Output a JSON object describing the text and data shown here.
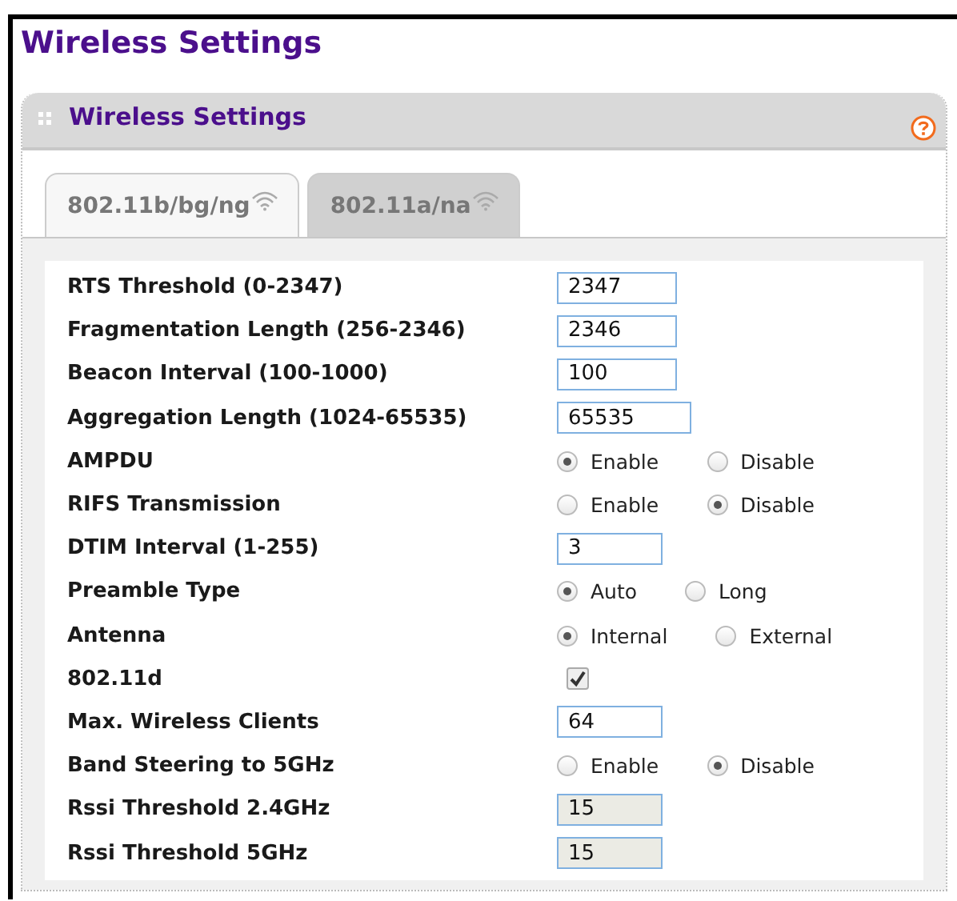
{
  "title": "Wireless Settings",
  "panel": {
    "title": "Wireless Settings"
  },
  "tabs": [
    {
      "label": "802.11b/bg/ng",
      "selected": true
    },
    {
      "label": "802.11a/na",
      "selected": false
    }
  ],
  "rows": [
    {
      "kind": "text",
      "label": "RTS Threshold (0-2347)",
      "value": "2347",
      "disabled": false
    },
    {
      "kind": "text",
      "label": "Fragmentation Length (256-2346)",
      "value": "2346",
      "disabled": false
    },
    {
      "kind": "text",
      "label": "Beacon Interval (100-1000)",
      "value": "100",
      "disabled": false
    },
    {
      "kind": "text",
      "label": "Aggregation Length (1024-65535)",
      "value": "65535",
      "disabled": false
    },
    {
      "kind": "radio",
      "label": "AMPDU",
      "options": [
        {
          "label": "Enable",
          "selected": true
        },
        {
          "label": "Disable",
          "selected": false
        }
      ]
    },
    {
      "kind": "radio",
      "label": "RIFS Transmission",
      "options": [
        {
          "label": "Enable",
          "selected": false
        },
        {
          "label": "Disable",
          "selected": true
        }
      ]
    },
    {
      "kind": "text",
      "label": "DTIM Interval (1-255)",
      "value": "3",
      "disabled": false
    },
    {
      "kind": "radio",
      "label": "Preamble Type",
      "options": [
        {
          "label": "Auto",
          "selected": true
        },
        {
          "label": "Long",
          "selected": false
        }
      ]
    },
    {
      "kind": "radio",
      "label": "Antenna",
      "options": [
        {
          "label": "Internal",
          "selected": true
        },
        {
          "label": "External",
          "selected": false
        }
      ]
    },
    {
      "kind": "checkbox",
      "label": "802.11d",
      "checked": true
    },
    {
      "kind": "text",
      "label": "Max. Wireless Clients",
      "value": "64",
      "disabled": false
    },
    {
      "kind": "radio",
      "label": "Band Steering to 5GHz",
      "options": [
        {
          "label": "Enable",
          "selected": false
        },
        {
          "label": "Disable",
          "selected": true
        }
      ]
    },
    {
      "kind": "text",
      "label": "Rssi Threshold 2.4GHz",
      "value": "15",
      "disabled": true
    },
    {
      "kind": "text",
      "label": "Rssi Threshold 5GHz",
      "value": "15",
      "disabled": true
    }
  ]
}
